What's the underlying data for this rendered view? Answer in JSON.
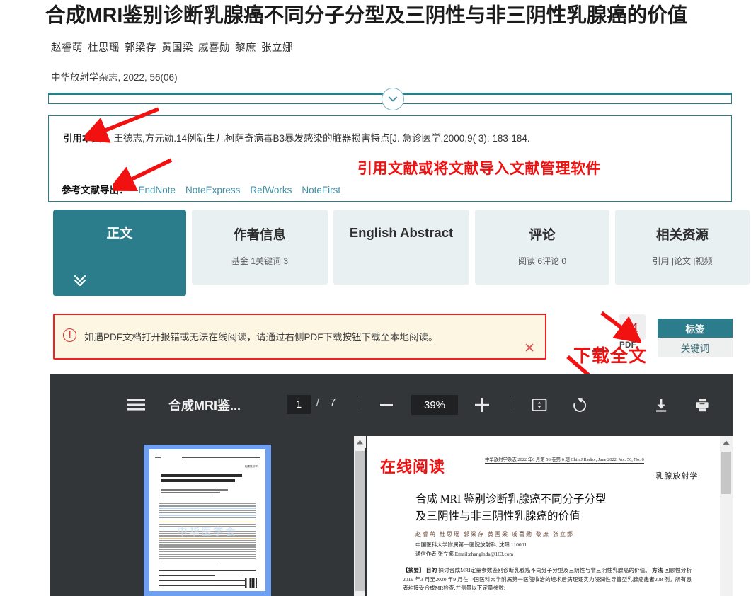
{
  "article": {
    "title": "合成MRI鉴别诊断乳腺癌不同分子分型及三阴性与非三阴性乳腺癌的价值",
    "authors": [
      "赵睿萌",
      "杜思瑶",
      "郭梁存",
      "黄国梁",
      "戚喜勋",
      "黎庶",
      "张立娜"
    ],
    "source": "中华放射学杂志, 2022, 56(06)"
  },
  "citation": {
    "label": "引用本文：",
    "text": "王德志,方元勋.14例新生儿柯萨奇病毒B3暴发感染的脏器损害特点[J. 急诊医学,2000,9( 3): 183-184.",
    "export_label": "参考文献导出：",
    "export_links": [
      "EndNote",
      "NoteExpress",
      "RefWorks",
      "NoteFirst"
    ],
    "annotation": "引用文献或将文献导入文献管理软件"
  },
  "tabs": [
    {
      "label": "正文",
      "sub": "",
      "active": true
    },
    {
      "label": "作者信息",
      "sub": "基金 1关键词 3",
      "active": false
    },
    {
      "label": "English Abstract",
      "sub": "",
      "active": false
    },
    {
      "label": "评论",
      "sub": "阅读 6评论 0",
      "active": false
    },
    {
      "label": "相关资源",
      "sub": "引用 |论文 |视频",
      "active": false
    }
  ],
  "alert": {
    "icon": "warning-icon",
    "message": "如遇PDF文档打开报错或无法在线阅读，请通过右侧PDF下载按钮下载至本地阅读。",
    "close": "✕"
  },
  "download": {
    "pdf_label": "PDF",
    "annotation": "下载全文",
    "tag_button": "标签",
    "keyword_button": "关键词"
  },
  "viewer": {
    "doc_title": "合成MRI鉴...",
    "page_current": "1",
    "page_separator": "/",
    "page_total": "7",
    "zoom": "39%",
    "icons": {
      "menu": "hamburger-menu-icon",
      "minus": "zoom-out-icon",
      "plus": "zoom-in-icon",
      "fit": "fit-to-page-icon",
      "rotate": "rotate-icon",
      "download": "download-icon",
      "print": "print-icon",
      "more": "more-options-icon"
    }
  },
  "document": {
    "online_read_annotation": "在线阅读",
    "running_head": "中华放射学杂志 2022 年6 月第 56 卷第 6 期    Chin J Radiol, June 2022, Vol. 56, No. 6",
    "section": "·乳腺放射学·",
    "title_line1": "合成 MRI 鉴别诊断乳腺癌不同分子分型",
    "title_line2": "及三阴性与非三阴性乳腺癌的价值",
    "authors": "赵睿萌   杜思瑶   郭梁存   黄国梁   戚喜勋   黎庶   张立娜",
    "affiliation": "中国医科大学附属第一医院放射科, 沈阳 110001",
    "corresponding": "通信作者:张立娜,Email:zhanglnda@163.com",
    "abstract_label": "【摘要】",
    "abstract_objective_label": "目的",
    "abstract_objective": "探讨合成MRI定量参数鉴别诊断乳腺癌不同分子分型及三阴性与非三阴性乳腺癌的价值。",
    "abstract_methods_label": "方法",
    "abstract_methods": "回顾性分析2019 年3 月至2020 年9 月在中国医科大学附属第一医院收治的经术后病理证实为浸润性导管型乳腺癌患者208 例。所有患者均接受合成MR检查,并测量以下定量参数:"
  },
  "colors": {
    "teal": "#2b7d8c",
    "red_annotation": "#f01010",
    "alert_bg": "#fdf6e3",
    "alert_border": "#ee2222",
    "viewer_bg": "#323639",
    "tab_inactive": "#e9f0f2"
  }
}
